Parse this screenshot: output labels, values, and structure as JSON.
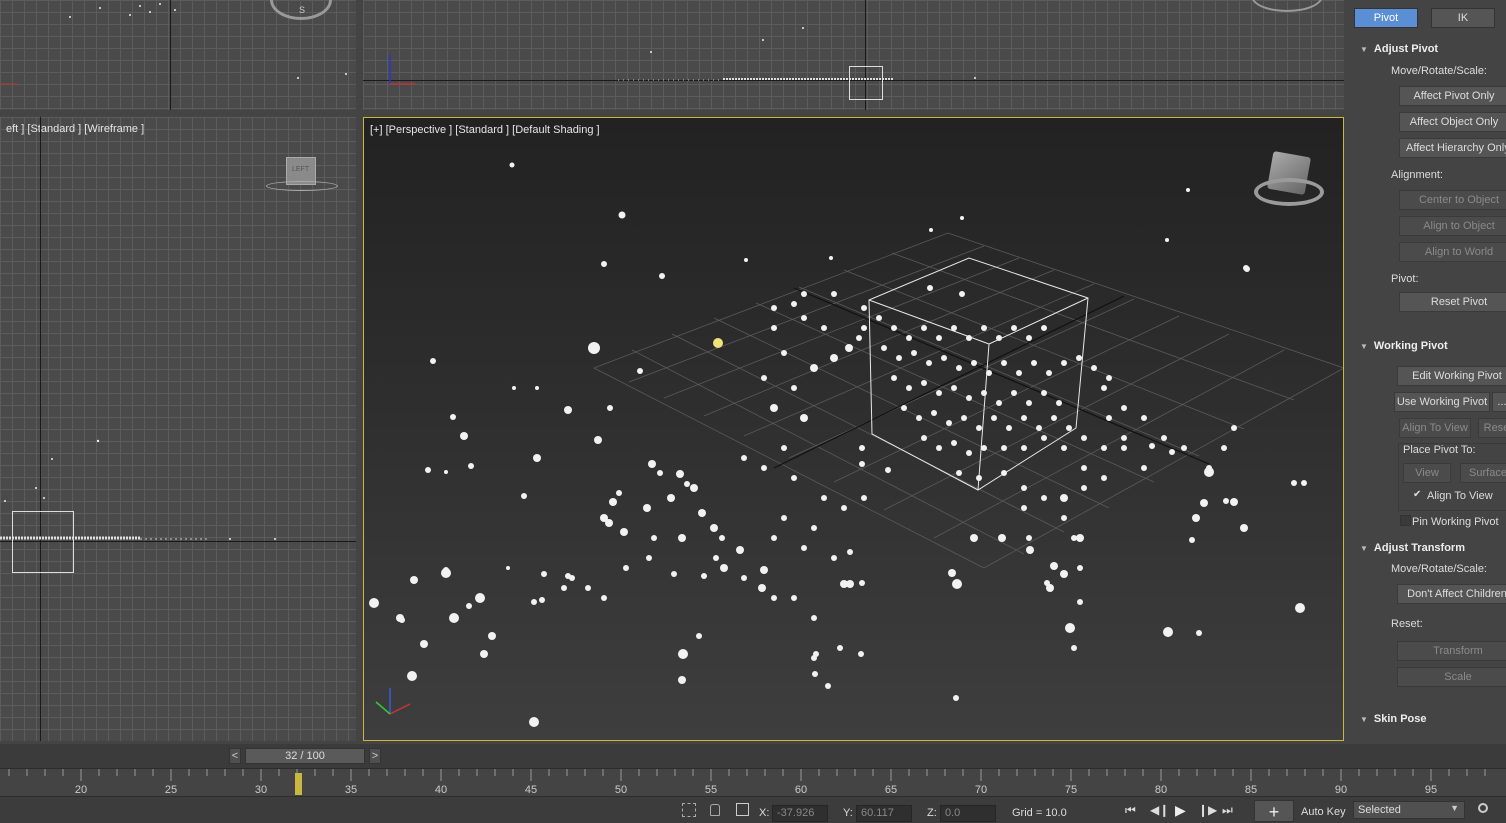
{
  "viewports": {
    "left_label": "eft ] [Standard ] [Wireframe ]",
    "persp_label": "[+] [Perspective ] [Standard ] [Default Shading ]",
    "viewcube_left_text": "LEFT",
    "viewcube_top_text": "S"
  },
  "panel": {
    "tabs": [
      "Pivot",
      "IK"
    ],
    "adjust_pivot": {
      "title": "Adjust Pivot",
      "move_label": "Move/Rotate/Scale:",
      "buttons": [
        "Affect Pivot Only",
        "Affect Object Only",
        "Affect Hierarchy Only"
      ],
      "alignment_label": "Alignment:",
      "align_buttons": [
        "Center to Object",
        "Align to Object",
        "Align to World"
      ],
      "pivot_label": "Pivot:",
      "reset_pivot": "Reset Pivot"
    },
    "working_pivot": {
      "title": "Working Pivot",
      "edit": "Edit Working Pivot",
      "use": "Use Working Pivot",
      "use_extra": "...",
      "align_to_view": "Align To View",
      "reset": "Reset",
      "place_label": "Place Pivot To:",
      "view": "View",
      "surface": "Surface",
      "align_check": "Align To View",
      "pin": "Pin Working Pivot"
    },
    "adjust_transform": {
      "title": "Adjust Transform",
      "move_label": "Move/Rotate/Scale:",
      "dont_affect": "Don't Affect Children",
      "reset_label": "Reset:",
      "transform": "Transform",
      "scale": "Scale"
    },
    "skin_pose": {
      "title": "Skin Pose"
    }
  },
  "timeline": {
    "frame_display": "32 / 100",
    "prev": "<",
    "next": ">",
    "current_frame": 32,
    "ticks": [
      "20",
      "25",
      "30",
      "35",
      "40",
      "45",
      "50",
      "55",
      "60",
      "65",
      "70",
      "75",
      "80",
      "85",
      "90",
      "95"
    ]
  },
  "status": {
    "x_label": "X:",
    "x_value": "-37.926",
    "y_label": "Y:",
    "y_value": "60.117",
    "z_label": "Z:",
    "z_value": "0.0",
    "grid": "Grid = 10.0",
    "auto_key": "Auto Key",
    "selected": "Selected"
  },
  "colors": {
    "active_border": "#c9b840",
    "tab_active": "#5a8fd6",
    "highlight_particle": "#f2e27a"
  }
}
